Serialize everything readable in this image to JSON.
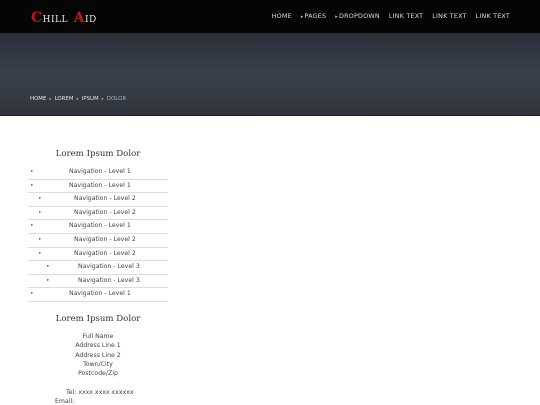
{
  "logo": {
    "c": "C",
    "hill": "HILL",
    "a": "A",
    "id": "ID"
  },
  "nav": {
    "home": "HOME",
    "pages": "PAGES",
    "dropdown": "DROPDOWN",
    "link1": "LINK TEXT",
    "link2": "LINK TEXT",
    "link3": "LINK TEXT"
  },
  "breadcrumb": {
    "home": "HOME",
    "lorem": "LOREM",
    "ipsum": "IPSUM",
    "current": "DOLOR"
  },
  "sidebar": {
    "title": "Lorem Ipsum Dolor",
    "items": [
      {
        "label": "Navigation - Level 1"
      },
      {
        "label": "Navigation - Level 1"
      },
      {
        "label": "Navigation - Level 2"
      },
      {
        "label": "Navigation - Level 2"
      },
      {
        "label": "Navigation - Level 1"
      },
      {
        "label": "Navigation - Level 2"
      },
      {
        "label": "Navigation - Level 2"
      },
      {
        "label": "Navigation - Level 3"
      },
      {
        "label": "Navigation - Level 3"
      },
      {
        "label": "Navigation - Level 1"
      }
    ]
  },
  "contact": {
    "title": "Lorem Ipsum Dolor",
    "name": "Full Name",
    "address1": "Address Line 1",
    "address2": "Address Line 2",
    "town": "Town/City",
    "postcode": "Postcode/Zip",
    "tel_label": "Tel:",
    "tel_value": "xxxx xxxx xxxxxx",
    "email_label": "Email:"
  },
  "colors": {
    "topbar": "#050505",
    "logo_red": "#c0161a",
    "hero": "#3a4049"
  }
}
